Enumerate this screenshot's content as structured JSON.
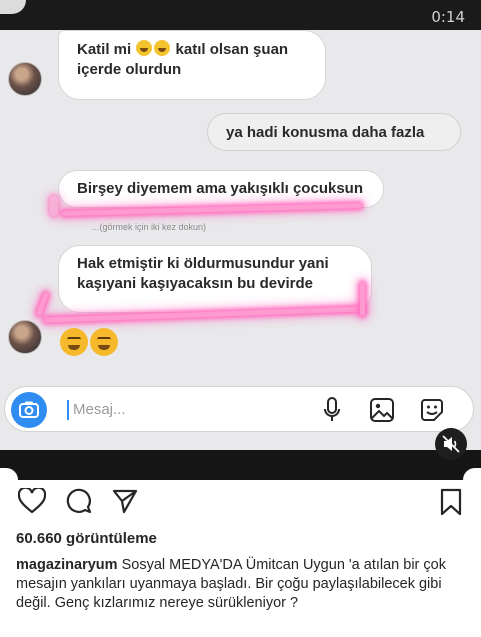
{
  "status_bar": {
    "time": "0:14"
  },
  "chat": {
    "messages": {
      "m1": {
        "line1_a": "Katil mi",
        "line1_b": "katıl olsan şuan",
        "line2": "içerde olurdun"
      },
      "m2": {
        "text": "ya hadi konusma daha fazla"
      },
      "m3": {
        "text": "Birşey diyemem ama yakışıklı çocuksun"
      },
      "hint": "...(görmek için iki kez dokun)",
      "m4": {
        "line1": "Hak etmiştir ki öldurmusundur yani",
        "line2": "kaşıyani kaşıyacaksın bu devirde"
      }
    },
    "composer": {
      "placeholder": "Mesaj..."
    }
  },
  "post": {
    "views": "60.660 görüntüleme",
    "username": "magazinaryum",
    "caption": "Sosyal MEDYA'DA Ümitcan Uygun 'a atılan bir çok mesajın yankıları uyanmaya başladı. Bir çoğu paylaşılabilecek gibi değil. Genç kızlarımız nereye sürükleniyor ?"
  },
  "icons": {
    "camera": "camera-icon",
    "mic": "microphone-icon",
    "image": "image-icon",
    "sticker": "sticker-icon",
    "mute": "mute-icon",
    "heart": "heart-icon",
    "comment": "comment-icon",
    "share": "share-icon",
    "save": "bookmark-icon"
  },
  "colors": {
    "accent": "#2f8cf0",
    "highlight": "#ff6fbd"
  }
}
